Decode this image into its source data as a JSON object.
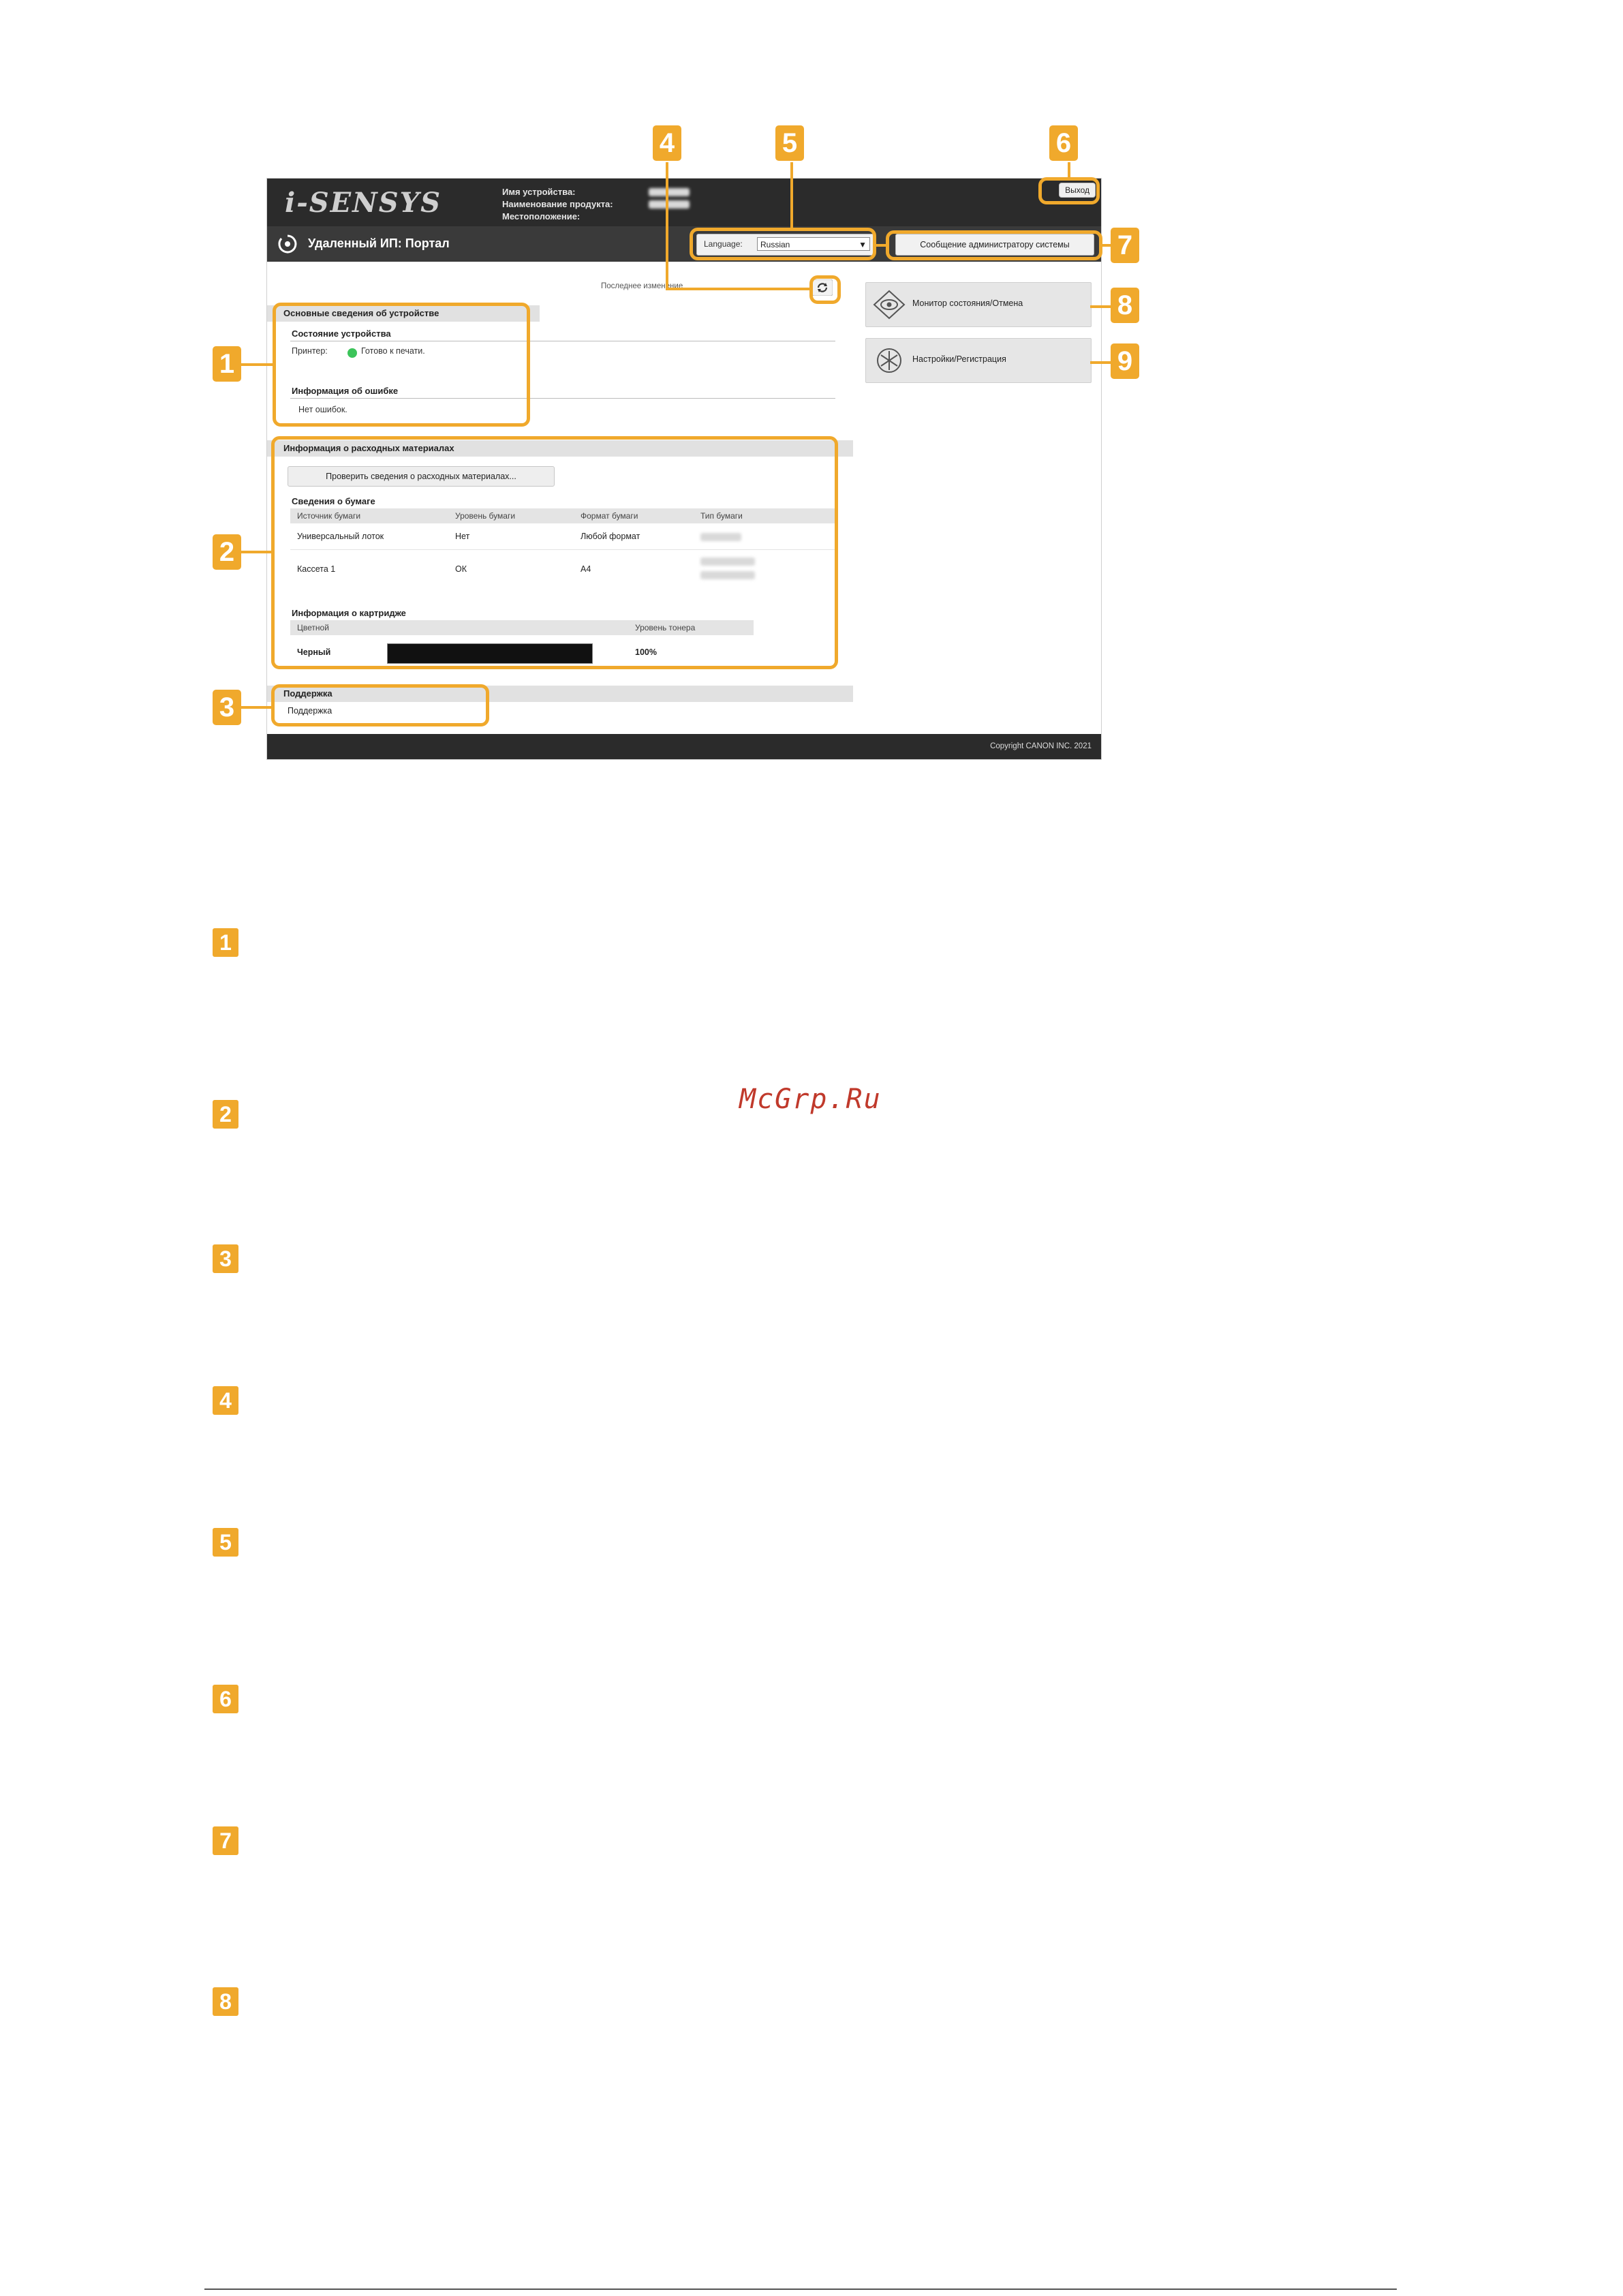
{
  "header": {
    "logo_text": "i-SENSYS",
    "device_name_label": "Имя устройства:",
    "product_name_label": "Наименование продукта:",
    "location_label": "Местоположение:",
    "logout_label": "Выход"
  },
  "titlebar": {
    "title": "Удаленный ИП: Портал",
    "language_label": "Language:",
    "language_value": "Russian",
    "message_button": "Сообщение администратору системы"
  },
  "last_updated": "Последнее изменение",
  "device_basic": {
    "heading": "Основные сведения об устройстве",
    "status_heading": "Состояние устройства",
    "printer_label": "Принтер:",
    "printer_status": "Готово к печати.",
    "status_color": "#3cc45a",
    "error_heading": "Информация об ошибке",
    "error_value": "Нет ошибок."
  },
  "consumables": {
    "heading": "Информация о расходных материалах",
    "check_button": "Проверить сведения о расходных материалах...",
    "paper_heading": "Сведения о бумаге",
    "paper_columns": [
      "Источник бумаги",
      "Уровень бумаги",
      "Формат бумаги",
      "Тип бумаги"
    ],
    "paper_rows": [
      {
        "source": "Универсальный лоток",
        "level": "Нет",
        "size": "Любой формат"
      },
      {
        "source": "Кассета 1",
        "level": "ОК",
        "size": "А4"
      }
    ],
    "cartridge_heading": "Информация о картридже",
    "cartridge_columns": [
      "Цветной",
      "Уровень тонера"
    ],
    "cartridge_rows": [
      {
        "color": "Черный",
        "level": "100%",
        "fill": 1.0
      }
    ]
  },
  "support": {
    "heading": "Поддержка",
    "link": "Поддержка"
  },
  "side": {
    "monitor_button": "Монитор состояния/Отмена",
    "settings_button": "Настройки/Регистрация"
  },
  "footer": {
    "copyright": "Copyright CANON INC. 2021"
  },
  "callouts": [
    "1",
    "2",
    "3",
    "4",
    "5",
    "6",
    "7",
    "8",
    "9"
  ],
  "list_numbers": [
    "1",
    "2",
    "3",
    "4",
    "5",
    "6",
    "7",
    "8"
  ],
  "watermark": "McGrp.Ru",
  "colors": {
    "accent": "#f0a92c",
    "dark": "#2b2b2b"
  }
}
